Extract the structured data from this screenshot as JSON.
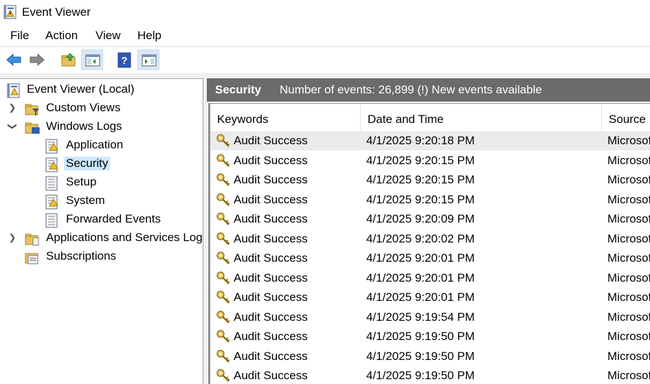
{
  "window": {
    "title": "Event Viewer",
    "icon": "event-viewer-icon"
  },
  "menu": [
    "File",
    "Action",
    "View",
    "Help"
  ],
  "toolbar": {
    "buttons": [
      {
        "name": "back-button",
        "icon": "arrow-left-icon"
      },
      {
        "name": "forward-button",
        "icon": "arrow-right-icon"
      },
      {
        "name": "up-folder-button",
        "icon": "folder-up-icon"
      },
      {
        "name": "show-hide-console-tree-button",
        "icon": "console-tree-icon"
      },
      {
        "name": "help-button",
        "icon": "help-icon"
      },
      {
        "name": "show-hide-action-pane-button",
        "icon": "action-pane-icon"
      }
    ]
  },
  "tree": {
    "root": "Event Viewer (Local)",
    "items": [
      {
        "label": "Custom Views",
        "expanded": false
      },
      {
        "label": "Windows Logs",
        "expanded": true
      },
      {
        "label": "Application"
      },
      {
        "label": "Security",
        "selected": true
      },
      {
        "label": "Setup"
      },
      {
        "label": "System"
      },
      {
        "label": "Forwarded Events"
      },
      {
        "label": "Applications and Services Logs",
        "expanded": false
      },
      {
        "label": "Subscriptions"
      }
    ]
  },
  "log": {
    "name": "Security",
    "info": "Number of events: 26,899 (!) New events available"
  },
  "columns": [
    "Keywords",
    "Date and Time",
    "Source"
  ],
  "rows": [
    {
      "keywords": "Audit Success",
      "datetime": "4/1/2025 9:20:18 PM",
      "source": "Microsoft Windows security auditing."
    },
    {
      "keywords": "Audit Success",
      "datetime": "4/1/2025 9:20:15 PM",
      "source": "Microsoft Windows security auditing."
    },
    {
      "keywords": "Audit Success",
      "datetime": "4/1/2025 9:20:15 PM",
      "source": "Microsoft Windows security auditing."
    },
    {
      "keywords": "Audit Success",
      "datetime": "4/1/2025 9:20:15 PM",
      "source": "Microsoft Windows security auditing."
    },
    {
      "keywords": "Audit Success",
      "datetime": "4/1/2025 9:20:09 PM",
      "source": "Microsoft Windows security auditing."
    },
    {
      "keywords": "Audit Success",
      "datetime": "4/1/2025 9:20:02 PM",
      "source": "Microsoft Windows security auditing."
    },
    {
      "keywords": "Audit Success",
      "datetime": "4/1/2025 9:20:01 PM",
      "source": "Microsoft Windows security auditing."
    },
    {
      "keywords": "Audit Success",
      "datetime": "4/1/2025 9:20:01 PM",
      "source": "Microsoft Windows security auditing."
    },
    {
      "keywords": "Audit Success",
      "datetime": "4/1/2025 9:20:01 PM",
      "source": "Microsoft Windows security auditing."
    },
    {
      "keywords": "Audit Success",
      "datetime": "4/1/2025 9:19:54 PM",
      "source": "Microsoft Windows security auditing."
    },
    {
      "keywords": "Audit Success",
      "datetime": "4/1/2025 9:19:50 PM",
      "source": "Microsoft Windows security auditing."
    },
    {
      "keywords": "Audit Success",
      "datetime": "4/1/2025 9:19:50 PM",
      "source": "Microsoft Windows security auditing."
    },
    {
      "keywords": "Audit Success",
      "datetime": "4/1/2025 9:19:50 PM",
      "source": "Microsoft Windows security auditing."
    }
  ],
  "colors": {
    "selection": "#cce8ff",
    "header_band": "#6b6b6b",
    "selected_row": "#ebebeb"
  }
}
